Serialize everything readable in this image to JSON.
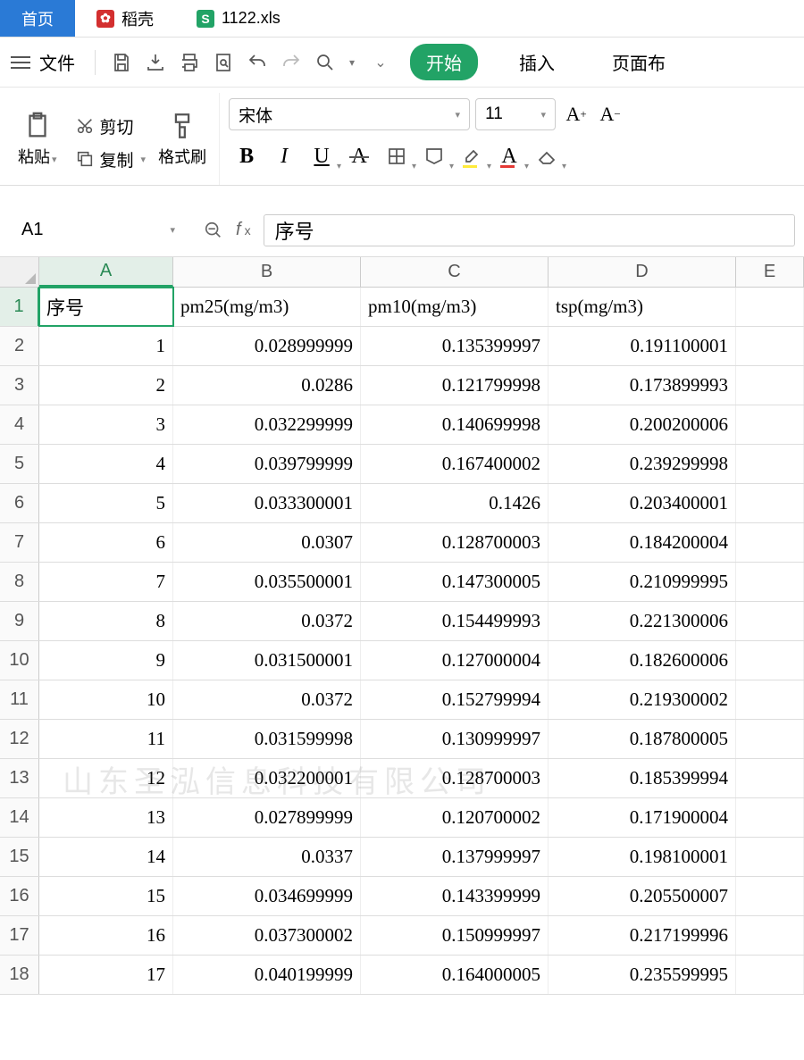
{
  "tabs": {
    "home": "首页",
    "docker": "稻壳",
    "file": "1122.xls"
  },
  "menu": {
    "file": "文件"
  },
  "ribbon": {
    "start": "开始",
    "insert": "插入",
    "page": "页面布"
  },
  "clipboard": {
    "paste": "粘贴",
    "cut": "剪切",
    "copy": "复制",
    "format_painter": "格式刷"
  },
  "font": {
    "name": "宋体",
    "size": "11"
  },
  "namebox": "A1",
  "formula_value": "序号",
  "columns": [
    "A",
    "B",
    "C",
    "D",
    "E"
  ],
  "headers": {
    "A": "序号",
    "B": "pm25(mg/m3)",
    "C": "pm10(mg/m3)",
    "D": "tsp(mg/m3)"
  },
  "rows": [
    {
      "n": "1",
      "a": "1",
      "b": "0.028999999",
      "c": "0.135399997",
      "d": "0.191100001"
    },
    {
      "n": "2",
      "a": "2",
      "b": "0.0286",
      "c": "0.121799998",
      "d": "0.173899993"
    },
    {
      "n": "3",
      "a": "3",
      "b": "0.032299999",
      "c": "0.140699998",
      "d": "0.200200006"
    },
    {
      "n": "4",
      "a": "4",
      "b": "0.039799999",
      "c": "0.167400002",
      "d": "0.239299998"
    },
    {
      "n": "5",
      "a": "5",
      "b": "0.033300001",
      "c": "0.1426",
      "d": "0.203400001"
    },
    {
      "n": "6",
      "a": "6",
      "b": "0.0307",
      "c": "0.128700003",
      "d": "0.184200004"
    },
    {
      "n": "7",
      "a": "7",
      "b": "0.035500001",
      "c": "0.147300005",
      "d": "0.210999995"
    },
    {
      "n": "8",
      "a": "8",
      "b": "0.0372",
      "c": "0.154499993",
      "d": "0.221300006"
    },
    {
      "n": "9",
      "a": "9",
      "b": "0.031500001",
      "c": "0.127000004",
      "d": "0.182600006"
    },
    {
      "n": "10",
      "a": "10",
      "b": "0.0372",
      "c": "0.152799994",
      "d": "0.219300002"
    },
    {
      "n": "11",
      "a": "11",
      "b": "0.031599998",
      "c": "0.130999997",
      "d": "0.187800005"
    },
    {
      "n": "12",
      "a": "12",
      "b": "0.032200001",
      "c": "0.128700003",
      "d": "0.185399994"
    },
    {
      "n": "13",
      "a": "13",
      "b": "0.027899999",
      "c": "0.120700002",
      "d": "0.171900004"
    },
    {
      "n": "14",
      "a": "14",
      "b": "0.0337",
      "c": "0.137999997",
      "d": "0.198100001"
    },
    {
      "n": "15",
      "a": "15",
      "b": "0.034699999",
      "c": "0.143399999",
      "d": "0.205500007"
    },
    {
      "n": "16",
      "a": "16",
      "b": "0.037300002",
      "c": "0.150999997",
      "d": "0.217199996"
    },
    {
      "n": "17",
      "a": "17",
      "b": "0.040199999",
      "c": "0.164000005",
      "d": "0.235599995"
    }
  ],
  "watermark": "山东圣泓信息科技有限公司"
}
